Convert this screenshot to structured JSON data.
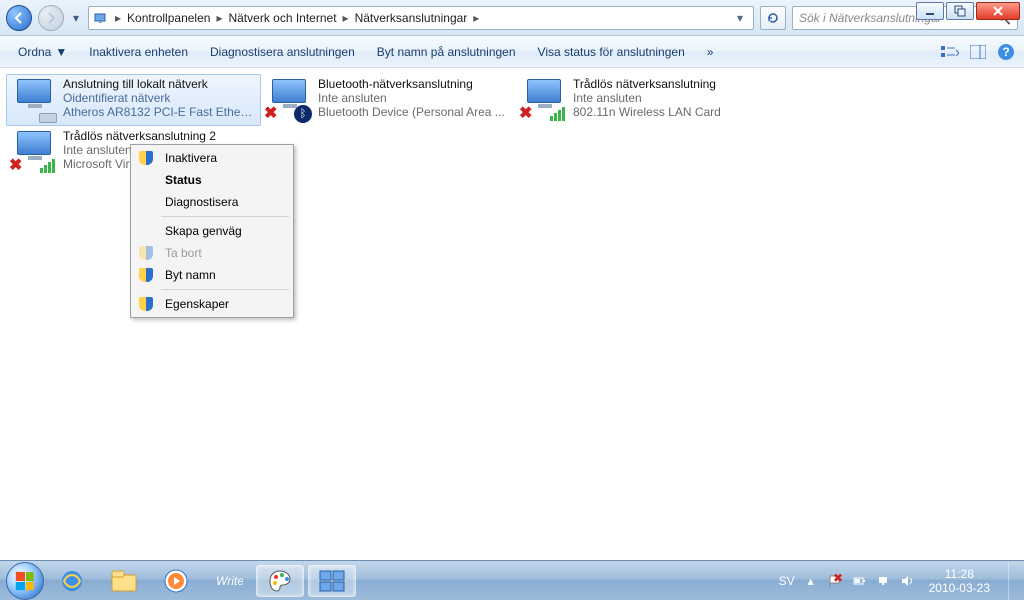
{
  "window": {
    "min": "_",
    "max": "▢",
    "close": "✕"
  },
  "breadcrumb": [
    "Kontrollpanelen",
    "Nätverk och Internet",
    "Nätverksanslutningar"
  ],
  "search": {
    "placeholder": "Sök i Nätverksanslutningar"
  },
  "toolbar": {
    "organize": "Ordna",
    "disable": "Inaktivera enheten",
    "diagnose": "Diagnostisera anslutningen",
    "rename": "Byt namn på anslutningen",
    "status": "Visa status för anslutningen",
    "more": "»"
  },
  "connections": [
    {
      "name": "Anslutning till lokalt nätverk",
      "status": "Oidentifierat nätverk",
      "device": "Atheros AR8132 PCI-E Fast Ethern...",
      "selected": true,
      "type": "lan"
    },
    {
      "name": "Bluetooth-nätverksanslutning",
      "status": "Inte ansluten",
      "device": "Bluetooth Device (Personal Area ...",
      "selected": false,
      "type": "bt"
    },
    {
      "name": "Trådlös nätverksanslutning",
      "status": "Inte ansluten",
      "device": "802.11n Wireless LAN Card",
      "selected": false,
      "type": "wifi"
    },
    {
      "name": "Trådlös nätverksanslutning 2",
      "status": "Inte ansluten",
      "device": "Microsoft Virtual WiFi Miniport A...",
      "selected": false,
      "type": "wifi"
    }
  ],
  "context_menu": {
    "disable": "Inaktivera",
    "status": "Status",
    "diagnose": "Diagnostisera",
    "shortcut": "Skapa genväg",
    "delete": "Ta bort",
    "rename": "Byt namn",
    "properties": "Egenskaper"
  },
  "tray": {
    "lang": "SV",
    "time": "11:28",
    "date": "2010-03-23"
  }
}
